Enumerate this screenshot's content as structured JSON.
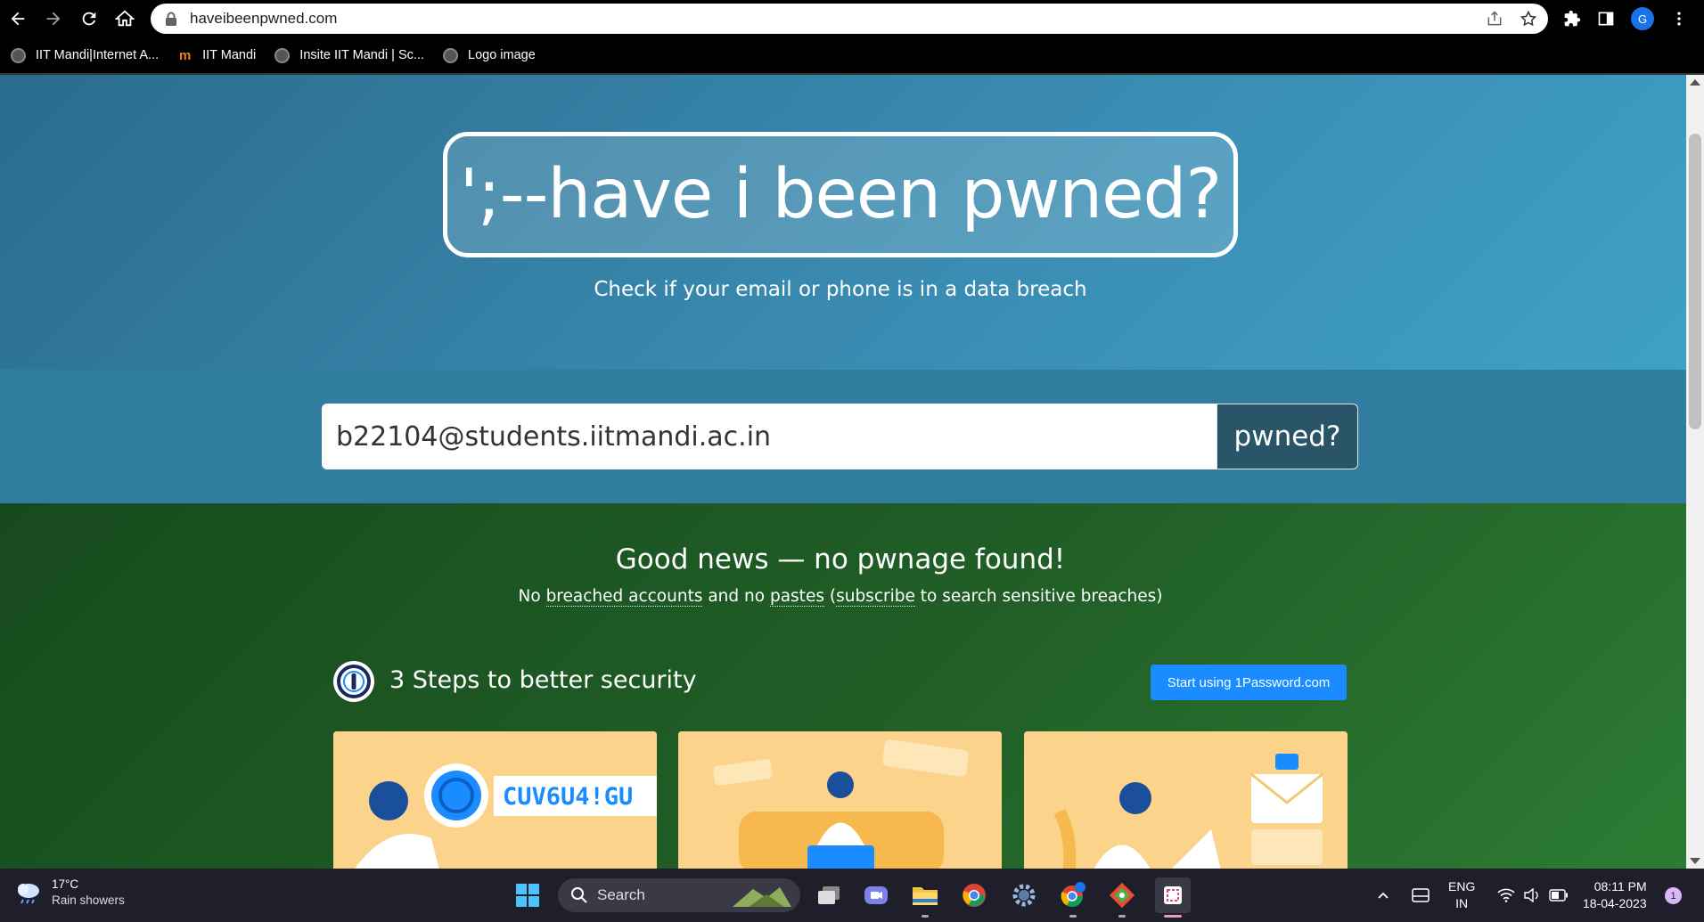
{
  "browser": {
    "url": "haveibeenpwned.com",
    "profile_initial": "G",
    "bookmarks": [
      {
        "label": "IIT Mandi|Internet A..."
      },
      {
        "label": "IIT Mandi"
      },
      {
        "label": "Insite IIT Mandi | Sc..."
      },
      {
        "label": "Logo image"
      }
    ]
  },
  "hero": {
    "logo": "';--have i been pwned?",
    "tagline": "Check if your email or phone is in a data breach"
  },
  "search": {
    "value": "b22104@students.iitmandi.ac.in",
    "button_label": "pwned?"
  },
  "result": {
    "headline": "Good news — no pwnage found!",
    "sub_part1": "No ",
    "sub_link1": "breached accounts",
    "sub_part2": " and no ",
    "sub_link2": "pastes",
    "sub_part3": " (",
    "sub_link3": "subscribe",
    "sub_part4": " to search sensitive breaches)"
  },
  "steps": {
    "title": "3 Steps to better security",
    "cta": "Start using 1Password.com",
    "card1_text": "CUV6U4!GU"
  },
  "taskbar": {
    "temperature": "17°C",
    "weather": "Rain showers",
    "search_label": "Search",
    "lang_line1": "ENG",
    "lang_line2": "IN",
    "time": "08:11 PM",
    "date": "18-04-2023",
    "notification_count": "1"
  },
  "colors": {
    "hero_blue": "#3a8ab0",
    "search_band": "#317da0",
    "result_green": "#215f27",
    "pwned_button": "#2a5569",
    "cta_blue": "#1a8cff",
    "card_yellow": "#fbd38a"
  }
}
